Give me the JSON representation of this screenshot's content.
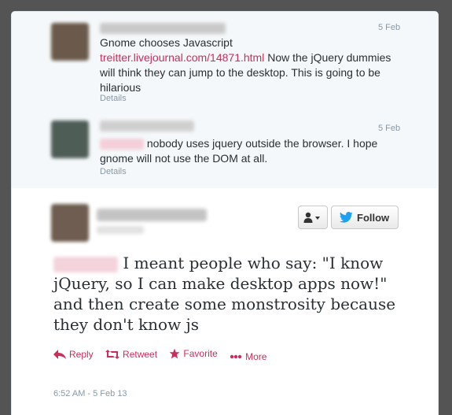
{
  "tweets": [
    {
      "date": "5 Feb",
      "text_before": "Gnome chooses Javascript",
      "link": "treitter.livejournal.com/14871.html",
      "text_after": " Now the jQuery dummies will think they can jump to the desktop. This is going to be hilarious",
      "details": "Details"
    },
    {
      "date": "5 Feb",
      "text": "nobody uses jquery outside the browser. I hope gnome will not use the DOM at all.",
      "details": "Details"
    }
  ],
  "main_tweet": {
    "follow_label": "Follow",
    "text": "I meant people who say: \"I know jQuery, so I can make desktop apps now!\" and then create some monstrosity because they don't know js",
    "actions": {
      "reply": "Reply",
      "retweet": "Retweet",
      "favorite": "Favorite",
      "more": "More"
    },
    "timestamp": "6:52 AM - 5 Feb 13"
  },
  "colors": {
    "accent": "#cc2d5a",
    "twitter_blue": "#1da1f2",
    "meta_gray": "#8899a6"
  },
  "icons": [
    "user-dropdown-icon",
    "twitter-bird-icon",
    "reply-icon",
    "retweet-icon",
    "favorite-star-icon",
    "more-dots-icon"
  ]
}
